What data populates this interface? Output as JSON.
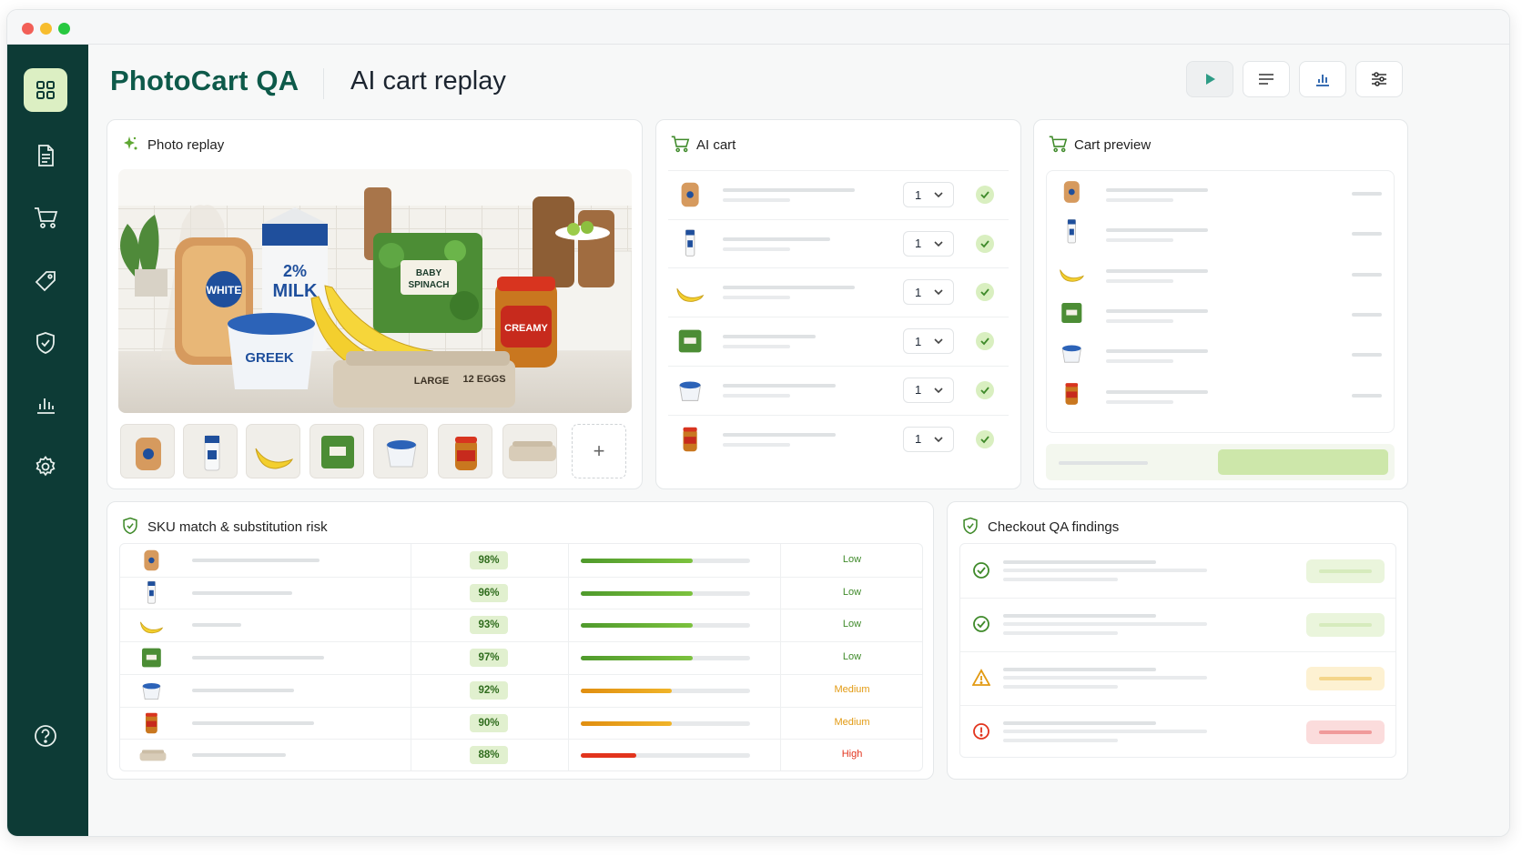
{
  "app": {
    "brand": "PhotoCart QA",
    "page_title": "AI cart replay"
  },
  "window": {
    "dots": [
      "#f25f57",
      "#f7bd2e",
      "#28c840"
    ]
  },
  "sidebar": {
    "items": [
      "grid-icon",
      "document-icon",
      "cart-icon",
      "tag-icon",
      "shield-icon",
      "bar-chart-icon",
      "gear-icon"
    ],
    "footer": "help-icon"
  },
  "toolbar": {
    "buttons": [
      "play-icon",
      "list-icon",
      "bar-chart-icon",
      "sliders-icon"
    ]
  },
  "photo_replay": {
    "title": "Photo replay",
    "thumbnails": [
      "bread",
      "milk",
      "bananas",
      "spinach",
      "greek-yogurt",
      "peanut-butter",
      "eggs"
    ],
    "add_label": "+",
    "photo_text": {
      "bread": "WHITE",
      "milk_1": "2%",
      "milk_2": "MILK",
      "spinach_1": "BABY",
      "spinach_2": "SPINACH",
      "yogurt": "GREEK",
      "pb": "CREAMY",
      "eggs_1": "LARGE",
      "eggs_2": "12 EGGS"
    }
  },
  "ai_cart": {
    "title": "AI cart",
    "rows": [
      {
        "product": "bread",
        "qty": "1"
      },
      {
        "product": "milk",
        "qty": "1"
      },
      {
        "product": "bananas",
        "qty": "1"
      },
      {
        "product": "spinach",
        "qty": "1"
      },
      {
        "product": "greek-yogurt",
        "qty": "1"
      },
      {
        "product": "peanut-butter",
        "qty": "1"
      }
    ]
  },
  "cart_preview": {
    "title": "Cart preview",
    "items": [
      "bread",
      "milk",
      "bananas",
      "spinach",
      "greek-yogurt",
      "peanut-butter"
    ]
  },
  "sku_match": {
    "title": "SKU match & substitution risk",
    "rows": [
      {
        "product": "bread",
        "match": "98%",
        "score": 0.66,
        "risk": "Low"
      },
      {
        "product": "milk",
        "match": "96%",
        "score": 0.66,
        "risk": "Low"
      },
      {
        "product": "bananas",
        "match": "93%",
        "score": 0.66,
        "risk": "Low"
      },
      {
        "product": "spinach",
        "match": "97%",
        "score": 0.66,
        "risk": "Low"
      },
      {
        "product": "greek-yogurt",
        "match": "92%",
        "score": 0.54,
        "risk": "Medium"
      },
      {
        "product": "peanut-butter",
        "match": "90%",
        "score": 0.54,
        "risk": "Medium"
      },
      {
        "product": "eggs",
        "match": "88%",
        "score": 0.33,
        "risk": "High"
      }
    ],
    "risk_colors": {
      "Low": "#3f8a2a",
      "Medium": "#e29a12",
      "High": "#e2341d"
    }
  },
  "checkout_qa": {
    "title": "Checkout QA findings",
    "findings": [
      {
        "status": "pass",
        "icon": "check-circle-icon"
      },
      {
        "status": "pass",
        "icon": "check-circle-icon"
      },
      {
        "status": "warning",
        "icon": "warning-triangle-icon"
      },
      {
        "status": "error",
        "icon": "alert-circle-icon"
      }
    ]
  },
  "colors": {
    "sidebar": "#0d3b36",
    "brand": "#0e5a4a",
    "accent_green": "#5fa733",
    "medium": "#e29a12",
    "high": "#e2341d"
  }
}
